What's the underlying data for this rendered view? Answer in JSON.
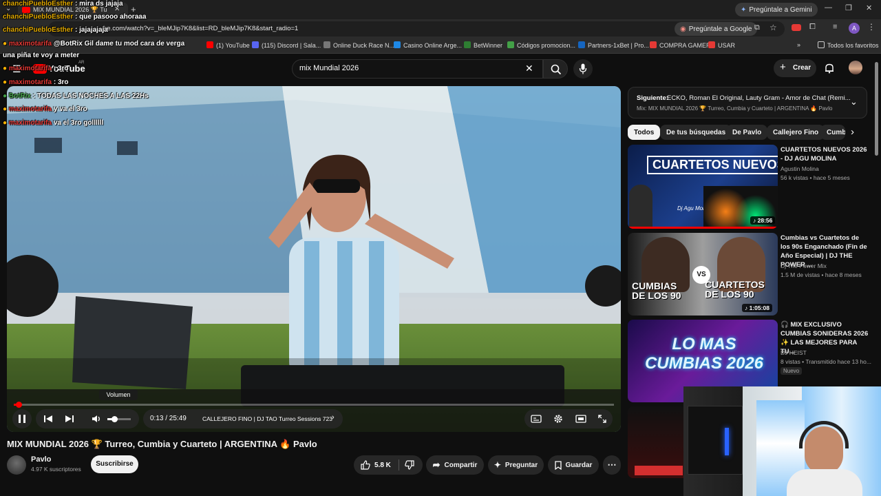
{
  "browser": {
    "tab_title": "MIX MUNDIAL 2026 🏆 Tu",
    "ask_gemini": "Pregúntale a Gemini",
    "url": "be.com/watch?v=_bleMJip7K8&list=RD_bleMJip7K8&start_radio=1",
    "ask_google": "Pregúntale a Google",
    "profile_initial": "A",
    "bookmarks": [
      "(1) YouTube",
      "(115) Discord | Sala...",
      "Online Duck Race N...",
      "Casino Online Arge...",
      "BetWinner",
      "Códigos promocion...",
      "Partners-1xBet | Pro...",
      "COMPRA GAMER",
      "USAR"
    ],
    "all_bookmarks": "Todos los favoritos"
  },
  "youtube": {
    "logo": "YouTube",
    "region": "AR",
    "search_value": "mix Mundial 2026",
    "create_label": "Crear"
  },
  "player": {
    "volume_tooltip": "Volumen",
    "time": "0:13 / 25:49",
    "chapter": "CALLEJERO FINO | DJ TAO Turreo Sessions 723",
    "progress": 0.008,
    "volume": 0.3
  },
  "video": {
    "title": "MIX MUNDIAL 2026 🏆 Turreo, Cumbia y Cuarteto | ARGENTINA 🔥 Pavlo",
    "channel": "Pavlo",
    "subscribers": "4.97 K suscriptores",
    "subscribe": "Suscribirse",
    "likes": "5.8 K",
    "share": "Compartir",
    "ask": "Preguntar",
    "save": "Guardar"
  },
  "playlist": {
    "next_prefix": "Siguiente:",
    "next_title": "ECKO, Roman El Original, Lauty Gram - Amor de Chat (Remi...",
    "mix_name": "Mix: MIX MUNDIAL 2026 🏆 Turreo, Cumbia y Cuarteto | ARGENTINA 🔥 Pavlo"
  },
  "chips": [
    "Todos",
    "De tus búsquedas",
    "De Pavlo",
    "Callejero Fino",
    "Cumb"
  ],
  "recommendations": [
    {
      "title": "CUARTETOS NUEVOS 2026 - DJ AGU MOLINA",
      "channel": "Agustin Molina",
      "meta": "56 k vistas • hace 5 meses",
      "duration": "28:56",
      "thumb_text": "CUARTETOS NUEVOS",
      "thumb_sub": "Dj Agu Molina"
    },
    {
      "title": "Cumbias vs Cuartetos de los 90s Enganchado (Fin de Año Especial) | DJ THE POWER ...",
      "channel": "Dj The Power Mix",
      "meta": "1.5 M de vistas • hace 8 meses",
      "duration": "1:05:08",
      "thumb_left": "CUMBIAS DE LOS 90",
      "thumb_right": "CUARTETOS DE LOS 90",
      "thumb_vs": "VS"
    },
    {
      "title": "🎧 MIX EXCLUSIVO CUMBIAS SONIDERAS 2026 ✨ LAS MEJORES PARA TU...",
      "channel": "DJ HEIST",
      "meta": "8 vistas • Transmitido hace 13 ho...",
      "badge": "Nuevo",
      "thumb_text": "LO MAS CUMBIAS 2026"
    }
  ],
  "chat": [
    {
      "user": "chanchiPuebloEsther",
      "text": ": mira ds jajaja"
    },
    {
      "user": "chanchiPuebloEsther",
      "text": ": que pasooo ahoraaa"
    },
    {
      "user": "chanchiPuebloEsther",
      "text": ": jajajajaja"
    },
    {
      "user": "maximotarifa",
      "text": "@BotRix Gil dame tu mod cara de verga"
    },
    {
      "user": "",
      "text": "una piña te voy a meter"
    },
    {
      "user": "maximotarifa",
      "text": ": 3ro"
    },
    {
      "user": "maximotarifa",
      "text": ": 3ro"
    },
    {
      "user": "BotRix",
      "text": ": TODAS LAS NOCHES A LAS 22Hs"
    },
    {
      "user": "maximotarifa",
      "text": "y va el 3ro"
    },
    {
      "user": "maximotarifa",
      "text": "va el 3ro gollllll"
    }
  ],
  "colors": {
    "bg": "#0f0f0f",
    "chip": "#272727",
    "accent": "#ff0000"
  }
}
